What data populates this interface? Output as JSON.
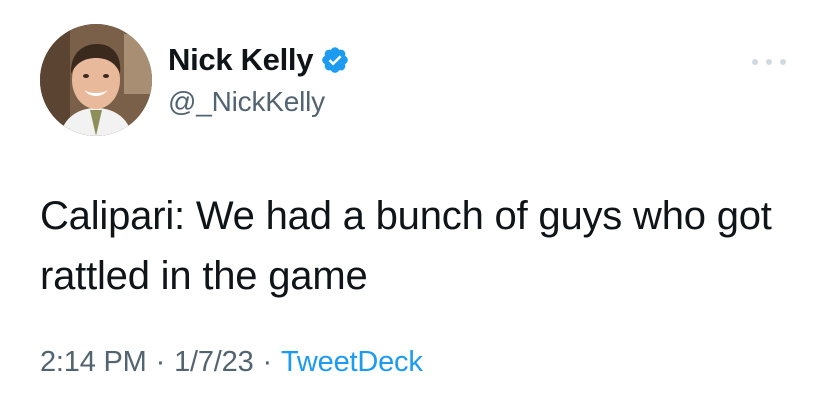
{
  "author": {
    "display_name": "Nick Kelly",
    "handle": "@_NickKelly",
    "verified": true
  },
  "tweet": {
    "text": "Calipari: We had a bunch of guys who got rattled in the game",
    "time": "2:14 PM",
    "separator": "·",
    "date": "1/7/23",
    "source": "TweetDeck"
  },
  "icons": {
    "verified": "verified-badge-icon",
    "more": "more-options-icon"
  },
  "colors": {
    "text": "#0f1419",
    "secondary": "#536471",
    "link": "#1d9bf0",
    "verified": "#1d9bf0"
  }
}
